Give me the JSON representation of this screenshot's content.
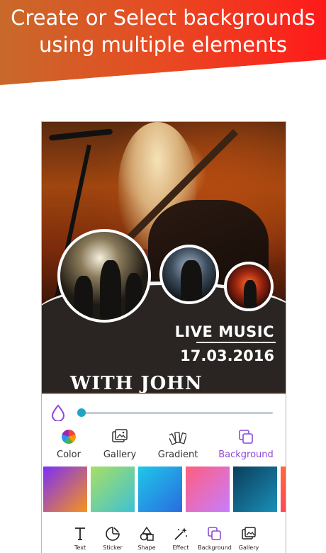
{
  "promo": {
    "line1": "Create or Select backgrounds",
    "line2": "using multiple elements",
    "gradient_start": "#c8692a",
    "gradient_end": "#ff1a1a"
  },
  "poster": {
    "headline": "LIVE MUSIC",
    "date": "17.03.2016",
    "subheadline": "WITH JOHN SMITH"
  },
  "opacity_slider": {
    "value": 0.0
  },
  "tabs": [
    {
      "label": "Color",
      "icon": "color-wheel-icon"
    },
    {
      "label": "Gallery",
      "icon": "gallery-icon"
    },
    {
      "label": "Gradient",
      "icon": "gradient-swatch-icon"
    },
    {
      "label": "Background",
      "icon": "background-layers-icon",
      "active": true
    }
  ],
  "swatches": [
    {
      "from": "#7b2ff7",
      "to": "#f7931e"
    },
    {
      "from": "#a8e063",
      "to": "#3ec1d3"
    },
    {
      "from": "#1fc8e8",
      "to": "#2a6be0"
    },
    {
      "from": "#ff5e7e",
      "to": "#c77dff"
    },
    {
      "from": "#0b3d5c",
      "to": "#1a8fb8"
    },
    {
      "from": "#ff6a3d",
      "to": "#ff2a6d"
    }
  ],
  "toolbar": [
    {
      "label": "Text",
      "icon": "text-icon"
    },
    {
      "label": "Sticker",
      "icon": "sticker-icon"
    },
    {
      "label": "Shape",
      "icon": "shape-icon"
    },
    {
      "label": "Effect",
      "icon": "magic-wand-icon"
    },
    {
      "label": "Background",
      "icon": "background-layers-icon"
    },
    {
      "label": "Gallery",
      "icon": "gallery-icon"
    }
  ],
  "colors": {
    "accent": "#8c49d8",
    "slider_thumb": "#21a3c4"
  }
}
